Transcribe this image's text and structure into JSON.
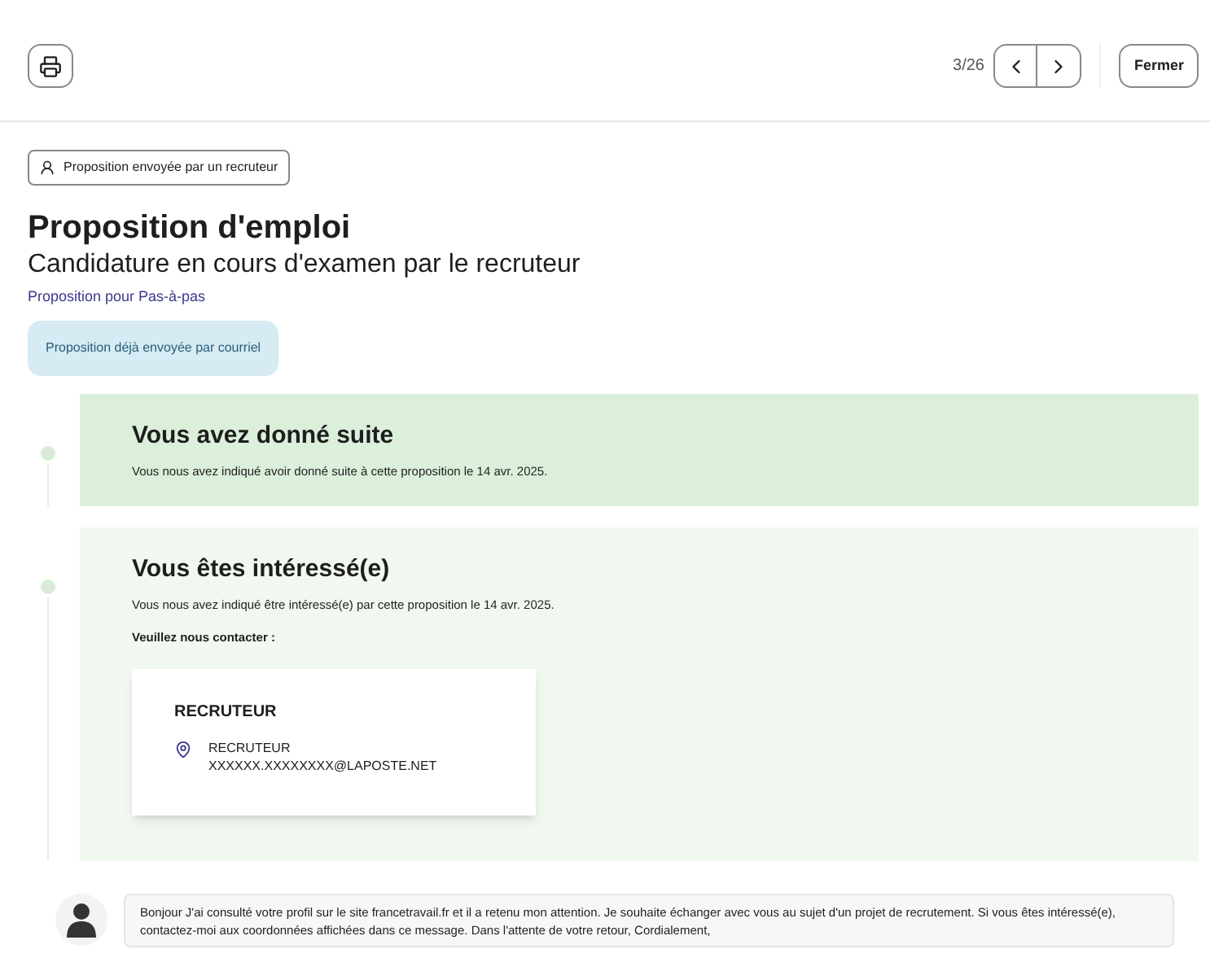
{
  "toolbar": {
    "pager": "3/26",
    "close": "Fermer"
  },
  "tag": "Proposition envoyée par un recruteur",
  "title": "Proposition d'emploi",
  "subtitle": "Candidature en cours d'examen par le recruteur",
  "link": "Proposition pour Pas-à-pas",
  "info": "Proposition déjà envoyée par courriel",
  "timeline": [
    {
      "title": "Vous avez donné suite",
      "text": "Vous nous avez indiqué avoir donné suite à cette proposition le 14 avr. 2025.",
      "color": "#dcefdb"
    },
    {
      "title": "Vous êtes intéressé(e)",
      "text": "Vous nous avez indiqué être intéressé(e) par cette proposition le 14 avr. 2025.",
      "color": "#f1f8ef",
      "prompt": "Veuillez nous contacter :",
      "contact": {
        "heading": "RECRUTEUR",
        "name": "RECRUTEUR",
        "email": "XXXXXX.XXXXXXXX@LAPOSTE.NET"
      }
    }
  ],
  "message": "Bonjour J'ai consulté votre profil sur le site francetravail.fr et il a retenu mon attention. Je souhaite échanger avec vous au sujet d'un projet de recrutement. Si vous êtes intéressé(e), contactez-moi aux coordonnées affichées dans ce message. Dans l'attente de votre retour, Cordialement,"
}
